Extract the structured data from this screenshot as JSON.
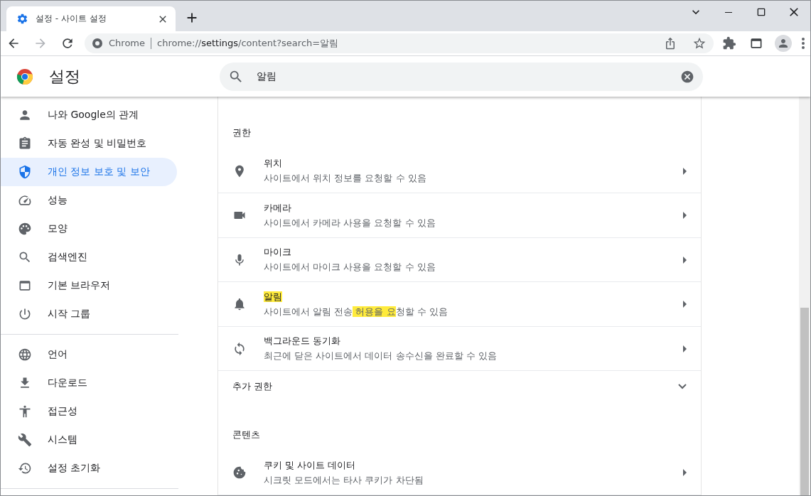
{
  "tab": {
    "title": "설정 - 사이트 설정",
    "selected": true
  },
  "address_bar": {
    "origin": "Chrome",
    "url_prefix": "chrome://",
    "url_host": "settings",
    "url_path": "/content?search=알림"
  },
  "header": {
    "title": "설정",
    "search_value": "알림"
  },
  "sidebar": {
    "groups": [
      {
        "items": [
          {
            "label": "나와 Google의 관계",
            "selected": false
          },
          {
            "label": "자동 완성 및 비밀번호",
            "selected": false
          },
          {
            "label": "개인 정보 보호 및 보안",
            "selected": true
          },
          {
            "label": "성능",
            "selected": false
          },
          {
            "label": "모양",
            "selected": false
          },
          {
            "label": "검색엔진",
            "selected": false
          },
          {
            "label": "기본 브라우저",
            "selected": false
          },
          {
            "label": "시작 그룹",
            "selected": false
          }
        ]
      },
      {
        "items": [
          {
            "label": "언어",
            "selected": false
          },
          {
            "label": "다운로드",
            "selected": false
          },
          {
            "label": "접근성",
            "selected": false
          },
          {
            "label": "시스템",
            "selected": false
          },
          {
            "label": "설정 초기화",
            "selected": false
          }
        ]
      }
    ]
  },
  "sections": [
    {
      "heading": "권한",
      "rows": [
        {
          "title": {
            "text": "위치",
            "highlighted": false
          },
          "description": [
            {
              "text": "사이트에서 위치 정보를 요청할 수 있음",
              "highlighted": false
            }
          ]
        },
        {
          "title": {
            "text": "카메라",
            "highlighted": false
          },
          "description": [
            {
              "text": "사이트에서 카메라 사용을 요청할 수 있음",
              "highlighted": false
            }
          ]
        },
        {
          "title": {
            "text": "마이크",
            "highlighted": false
          },
          "description": [
            {
              "text": "사이트에서 마이크 사용을 요청할 수 있음",
              "highlighted": false
            }
          ]
        },
        {
          "title": {
            "text": "알림",
            "highlighted": true
          },
          "description": [
            {
              "text": "사이트에서 알림 전송",
              "highlighted": false
            },
            {
              "text": " 허용을 요",
              "highlighted": true
            },
            {
              "text": "청할 수 있음",
              "highlighted": false
            }
          ]
        },
        {
          "title": {
            "text": "백그라운드 동기화",
            "highlighted": false
          },
          "description": [
            {
              "text": "최근에 닫은 사이트에서 데이터 송수신을 완료할 수 있음",
              "highlighted": false
            }
          ]
        }
      ],
      "more": {
        "label": "추가 권한",
        "expanded": false
      }
    },
    {
      "heading": "콘텐츠",
      "rows": [
        {
          "title": {
            "text": "쿠키 및 사이트 데이터",
            "highlighted": false
          },
          "description": [
            {
              "text": "시크릿 모드에서는 타사 쿠키가 차단됨",
              "highlighted": false
            }
          ]
        }
      ]
    }
  ]
}
